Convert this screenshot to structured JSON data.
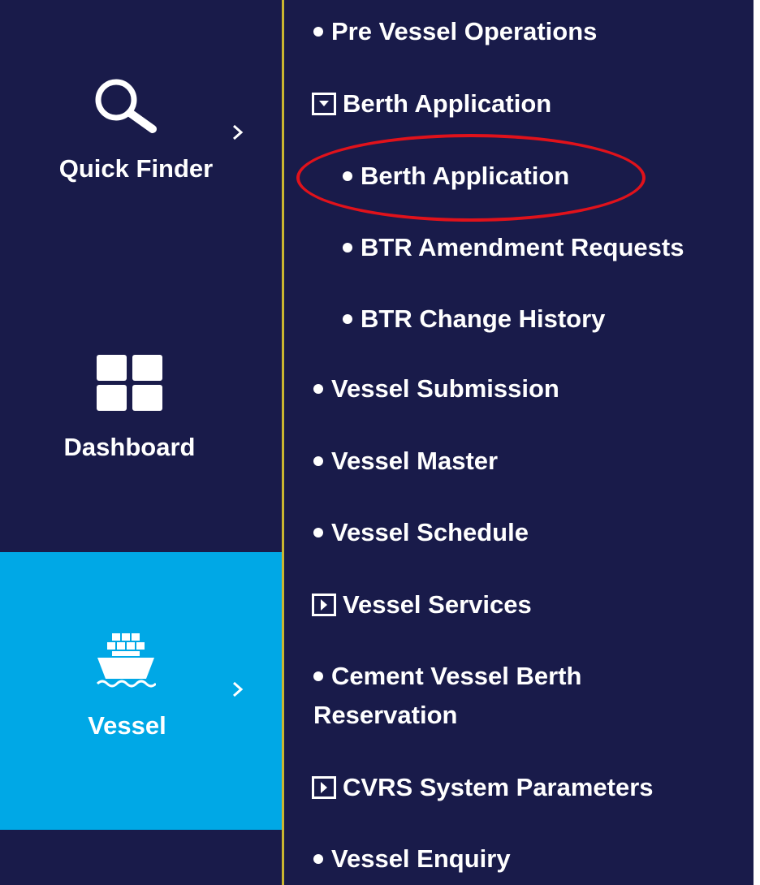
{
  "sidebar": {
    "items": [
      {
        "label": "Quick Finder",
        "icon": "search-icon",
        "active": false
      },
      {
        "label": "Dashboard",
        "icon": "dashboard-grid-icon",
        "active": false
      },
      {
        "label": "Vessel",
        "icon": "ship-icon",
        "active": true
      }
    ]
  },
  "submenu": {
    "items": [
      {
        "label": "Pre Vessel Operations",
        "marker": "bullet"
      },
      {
        "label": "Berth Application",
        "marker": "collapse-box"
      },
      {
        "label": "Berth Application",
        "marker": "bullet",
        "highlighted": true
      },
      {
        "label": "BTR Amendment Requests",
        "marker": "bullet"
      },
      {
        "label": "BTR Change History",
        "marker": "bullet"
      },
      {
        "label": "Vessel Submission",
        "marker": "bullet"
      },
      {
        "label": "Vessel Master",
        "marker": "bullet"
      },
      {
        "label": "Vessel Schedule",
        "marker": "bullet"
      },
      {
        "label": "Vessel Services",
        "marker": "expand-box"
      },
      {
        "label": "Cement Vessel Berth",
        "label_line2": "Reservation",
        "marker": "bullet"
      },
      {
        "label": "CVRS System Parameters",
        "marker": "expand-box"
      },
      {
        "label": "Vessel Enquiry",
        "marker": "bullet"
      }
    ]
  },
  "colors": {
    "background": "#191b4a",
    "active": "#00a8e6",
    "divider": "#c9b630",
    "highlight": "#e0121b"
  }
}
